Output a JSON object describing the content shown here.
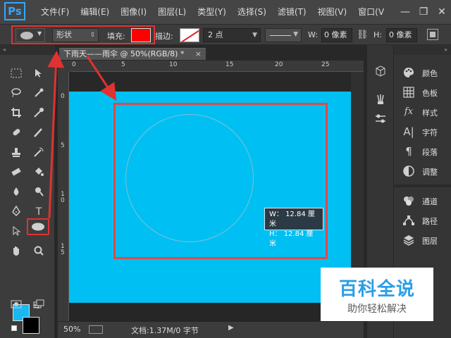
{
  "app": {
    "logo": "Ps"
  },
  "menu": {
    "items": [
      "文件(F)",
      "编辑(E)",
      "图像(I)",
      "图层(L)",
      "类型(Y)",
      "选择(S)",
      "滤镜(T)",
      "视图(V)",
      "窗口(V"
    ],
    "minimize": "—",
    "restore": "❐",
    "close": "✕"
  },
  "options": {
    "mode": "形状",
    "fill_label": "填充:",
    "fill_color": "#ff0000",
    "stroke_label": "描边:",
    "stroke_width": "2 点",
    "w_label": "W:",
    "w_value": "0 像素",
    "h_label": "H:",
    "h_value": "0 像素"
  },
  "tools": {
    "panel_header": "«",
    "fg_color": "#19b8f0",
    "bg_color": "#000000",
    "type_glyph": "T"
  },
  "document": {
    "tab_title": "下雨天——雨伞 @ 50%(RGB/8) *",
    "tab_close": "×",
    "canvas_color": "#00bff2",
    "ruler_top": [
      "0",
      "5",
      "10",
      "15",
      "20",
      "25"
    ],
    "ruler_left": [
      "0",
      "5",
      "1\n0",
      "1\n5"
    ]
  },
  "tooltip": {
    "w_line": "W： 12.84 厘米",
    "h_line": "H： 12.84 厘米"
  },
  "status": {
    "zoom": "50%",
    "doc_info": "文档:1.37M/0 字节",
    "arrow": "▶"
  },
  "right_panel": {
    "header": "»",
    "items": [
      "颜色",
      "色板",
      "样式",
      "字符",
      "段落",
      "调整",
      "通道",
      "路径",
      "图层"
    ]
  },
  "watermark": {
    "title": "百科全说",
    "subtitle": "助你轻松解决"
  }
}
